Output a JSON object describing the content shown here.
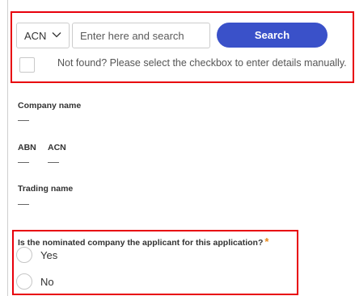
{
  "search": {
    "type_selected": "ACN",
    "input_placeholder": "Enter here and search",
    "input_value": "",
    "button_label": "Search",
    "manual_entry_text": "Not found? Please select the checkbox to enter details manually."
  },
  "details": {
    "company_name_label": "Company name",
    "company_name_value": "",
    "abn_label": "ABN",
    "abn_value": "",
    "acn_label": "ACN",
    "acn_value": "",
    "trading_name_label": "Trading name",
    "trading_name_value": ""
  },
  "question": {
    "text": "Is the nominated company the applicant for this application?",
    "required_marker": "*",
    "options": [
      "Yes",
      "No"
    ]
  },
  "colors": {
    "button": "#3a51c9",
    "highlight": "#e8000b",
    "required": "#e8891a"
  },
  "icons": {
    "select_chevron": "chevron-down-icon"
  }
}
